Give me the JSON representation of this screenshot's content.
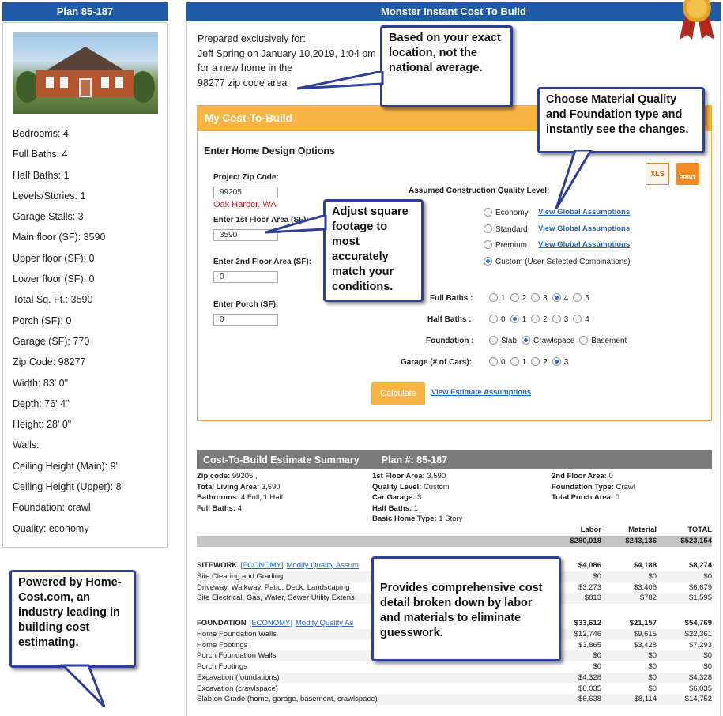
{
  "left": {
    "plan_title": "Plan 85-187",
    "specs": [
      "Bedrooms: 4",
      "Full Baths: 4",
      "Half Baths: 1",
      "Levels/Stories: 1",
      "Garage Stalls: 3",
      "Main floor (SF): 3590",
      "Upper floor (SF): 0",
      "Lower floor (SF): 0",
      "Total Sq. Ft.: 3590",
      "Porch (SF): 0",
      "Garage (SF): 770",
      "Zip Code: 98277",
      "Width: 83' 0\"",
      "Depth: 76' 4\"",
      "Height: 28' 0\"",
      "Walls:",
      "Ceiling Height (Main): 9'",
      "Ceiling Height (Upper): 8'",
      "Foundation: crawl",
      "Quality: economy"
    ]
  },
  "main": {
    "title": "Monster Instant Cost To Build",
    "prepared": {
      "line1": "Prepared exclusively for:",
      "line2": "Jeff Spring on January 10,2019, 1:04 pm",
      "line3": "for a new home in the",
      "line4": "98277 zip code area"
    },
    "box_title": "My Cost-To-Build",
    "section_title": "Enter Home Design Options",
    "zip_label": "Project Zip Code:",
    "zip_value": "99205",
    "city": "Oak Harbor, WA",
    "first_floor_label": "Enter 1st Floor Area (SF):",
    "first_floor_value": "3590",
    "second_floor_label": "Enter 2nd Floor Area (SF):",
    "second_floor_value": "0",
    "porch_label": "Enter Porch (SF):",
    "porch_value": "0",
    "quality_label": "Assumed Construction Quality Level:",
    "quality_options": [
      {
        "label": "Economy",
        "link": "View Global Assumptions",
        "selected": false
      },
      {
        "label": "Standard",
        "link": "View Global Assumptions",
        "selected": false
      },
      {
        "label": "Premium",
        "link": "View Global Assumptions",
        "selected": false
      },
      {
        "label": "Custom (User Selected Combinations)",
        "link": "",
        "selected": true
      }
    ],
    "full_baths_label": "Full Baths :",
    "full_baths": [
      "1",
      "2",
      "3",
      "4",
      "5"
    ],
    "full_baths_selected": "4",
    "half_baths_label": "Half Baths :",
    "half_baths": [
      "0",
      "1",
      "2",
      "3",
      "4"
    ],
    "half_baths_selected": "1",
    "foundation_label": "Foundation :",
    "foundation": [
      "Slab",
      "Crawlspace",
      "Basement"
    ],
    "foundation_selected": "Crawlspace",
    "garage_label": "Garage (# of Cars):",
    "garage": [
      "0",
      "1",
      "2",
      "3"
    ],
    "garage_selected": "3",
    "calculate": "Calculate",
    "estimate_link": "View Estimate Assumptions",
    "xls_label": "XLS",
    "print_label": "PRINT"
  },
  "summary": {
    "title": "Cost-To-Build Estimate Summary",
    "plan": "Plan #: 85-187",
    "col1": [
      {
        "k": "Zip code:",
        "v": "99205 ,"
      },
      {
        "k": "Total Living Area:",
        "v": "3,590"
      },
      {
        "k": "Bathrooms:",
        "v": "4 Full; 1 Half"
      },
      {
        "k": "Full Baths:",
        "v": "4"
      }
    ],
    "col2": [
      {
        "k": "1st Floor Area:",
        "v": "3,590"
      },
      {
        "k": "Quality Level:",
        "v": "Custom"
      },
      {
        "k": "Car Garage:",
        "v": "3"
      },
      {
        "k": "Half Baths:",
        "v": "1"
      },
      {
        "k": "Basic Home Type:",
        "v": "1 Story"
      }
    ],
    "col3": [
      {
        "k": "2nd Floor Area:",
        "v": "0"
      },
      {
        "k": "Foundation Type:",
        "v": "Crawl"
      },
      {
        "k": "Total Porch Area:",
        "v": "0"
      }
    ],
    "headers": [
      "Labor",
      "Material",
      "TOTAL"
    ],
    "totals": [
      "$280,018",
      "$243,136",
      "$523,154"
    ],
    "sitework": {
      "name": "SITEWORK",
      "econ": "[ECONOMY]",
      "modify": "Modify Quality Assum",
      "vals": [
        "$4,086",
        "$4,188",
        "$8,274"
      ],
      "rows": [
        {
          "n": "Site Clearing and Grading",
          "v": [
            "$0",
            "$0",
            "$0"
          ]
        },
        {
          "n": "Driveway, Walkway, Patio, Deck, Landscaping",
          "v": [
            "$3,273",
            "$3,406",
            "$6,679"
          ]
        },
        {
          "n": "Site Electrical, Gas, Water, Sewer Utility Extens",
          "v": [
            "$813",
            "$782",
            "$1,595"
          ]
        }
      ]
    },
    "foundation": {
      "name": "FOUNDATION",
      "econ": "[ECONOMY]",
      "modify": "Modify Quality As",
      "vals": [
        "$33,612",
        "$21,157",
        "$54,769"
      ],
      "rows": [
        {
          "n": "Home Foundation Walls",
          "v": [
            "$12,746",
            "$9,615",
            "$22,361"
          ]
        },
        {
          "n": "Home Footings",
          "v": [
            "$3,865",
            "$3,428",
            "$7,293"
          ]
        },
        {
          "n": "Porch Foundation Walls",
          "v": [
            "$0",
            "$0",
            "$0"
          ]
        },
        {
          "n": "Porch Footings",
          "v": [
            "$0",
            "$0",
            "$0"
          ]
        },
        {
          "n": "Excavation (foundations)",
          "v": [
            "$4,328",
            "$0",
            "$4,328"
          ]
        },
        {
          "n": "Excavation (crawlspace)",
          "v": [
            "$6,035",
            "$0",
            "$6,035"
          ]
        },
        {
          "n": "Slab on Grade (home, garage, basement, crawlspace)",
          "v": [
            "$6,638",
            "$8,114",
            "$14,752"
          ]
        }
      ]
    }
  },
  "callouts": {
    "location": "Based on your exact location, not the national average.",
    "material": "Choose Material Quality and Foundation type and instantly see the changes.",
    "sqft": "Adjust square footage to most accurately match your conditions.",
    "detail": "Provides comprehensive cost detail broken down by labor and materials to eliminate guesswork.",
    "powered": "Powered by Home-Cost.com, an industry leading in building cost estimating."
  }
}
